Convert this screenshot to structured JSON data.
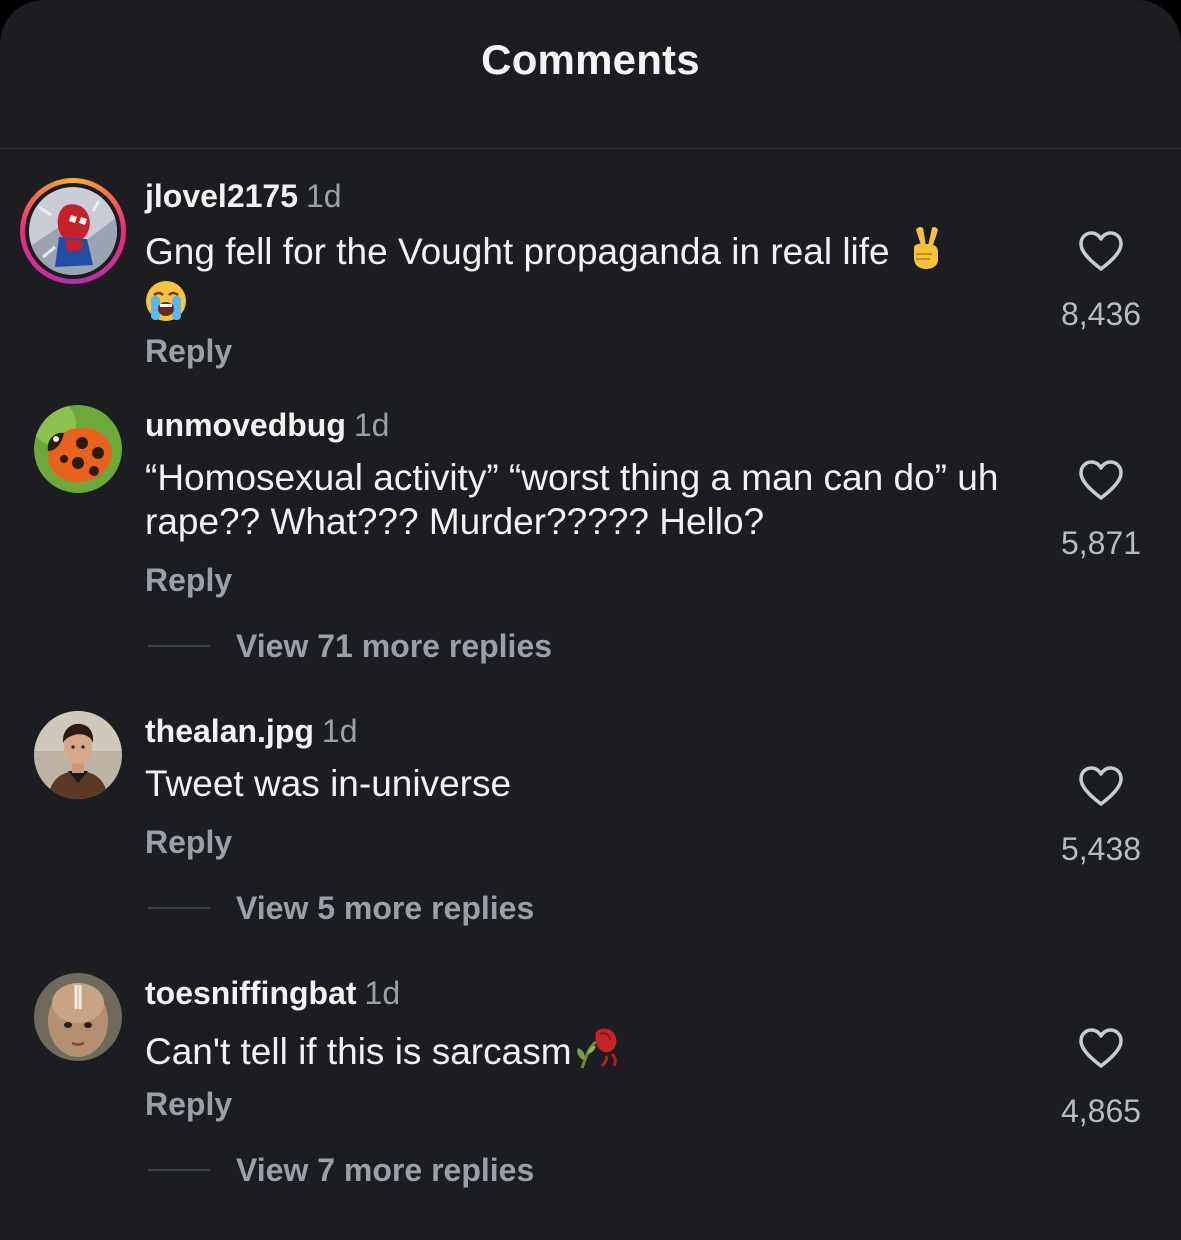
{
  "header": {
    "title": "Comments"
  },
  "comments": [
    {
      "username": "jlovel2175",
      "time": "1d",
      "text": "Gng fell for the Vought propaganda in real life",
      "reply_label": "Reply",
      "likes": "8,436",
      "avatar_icon": "spider-man-avatar-icon",
      "emojis": [
        "victory-hand-emoji",
        "loudly-crying-face-emoji"
      ]
    },
    {
      "username": "unmovedbug",
      "time": "1d",
      "text": "“Homosexual activity” “worst thing a man can do” uh rape?? What??? Murder????? Hello?",
      "reply_label": "Reply",
      "view_replies": "View 71 more replies",
      "likes": "5,871",
      "avatar_icon": "ladybug-avatar-icon"
    },
    {
      "username": "thealan.jpg",
      "time": "1d",
      "text": "Tweet was in-universe",
      "reply_label": "Reply",
      "view_replies": "View 5 more replies",
      "likes": "5,438",
      "avatar_icon": "person-photo-avatar-icon"
    },
    {
      "username": "toesniffingbat",
      "time": "1d",
      "text": "Can't tell if this is sarcasm",
      "reply_label": "Reply",
      "view_replies": "View 7 more replies",
      "likes": "4,865",
      "avatar_icon": "child-face-avatar-icon",
      "emojis": [
        "wilted-flower-emoji"
      ]
    }
  ],
  "colors": {
    "background": "#1b1d21",
    "primary_text": "#f2f2f2",
    "secondary_text": "#9aa0a8",
    "story_ring": [
      "#f8b12a",
      "#ee2a7b",
      "#b02fb0"
    ]
  }
}
